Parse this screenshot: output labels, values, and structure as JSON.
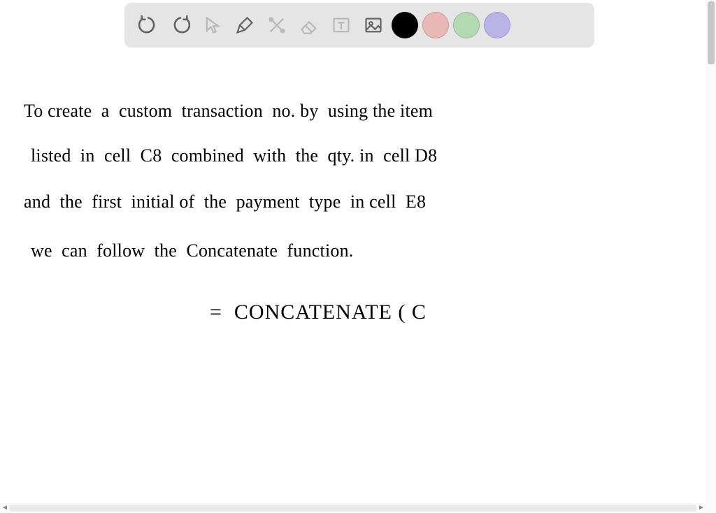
{
  "toolbar": {
    "tools": {
      "undo": "undo-icon",
      "redo": "redo-icon",
      "select": "cursor-icon",
      "pen": "pen-icon",
      "tools2": "crossed-tools-icon",
      "eraser": "eraser-icon",
      "textbox": "text-box-icon",
      "image": "image-icon"
    },
    "colors": {
      "black": "#000000",
      "pink": "#eab7b7",
      "green": "#b3d9b3",
      "purple": "#b9b3e8"
    },
    "selected_color": "black"
  },
  "canvas": {
    "line1": "To create  a  custom  transaction  no. by  using the item",
    "line2": "listed  in  cell  C8  combined  with  the  qty. in  cell D8",
    "line3": "and  the  first  initial of  the  payment  type  in cell  E8",
    "line4": "we  can  follow  the  Concatenate  function.",
    "line5": "=  CONCATENATE ( C"
  }
}
